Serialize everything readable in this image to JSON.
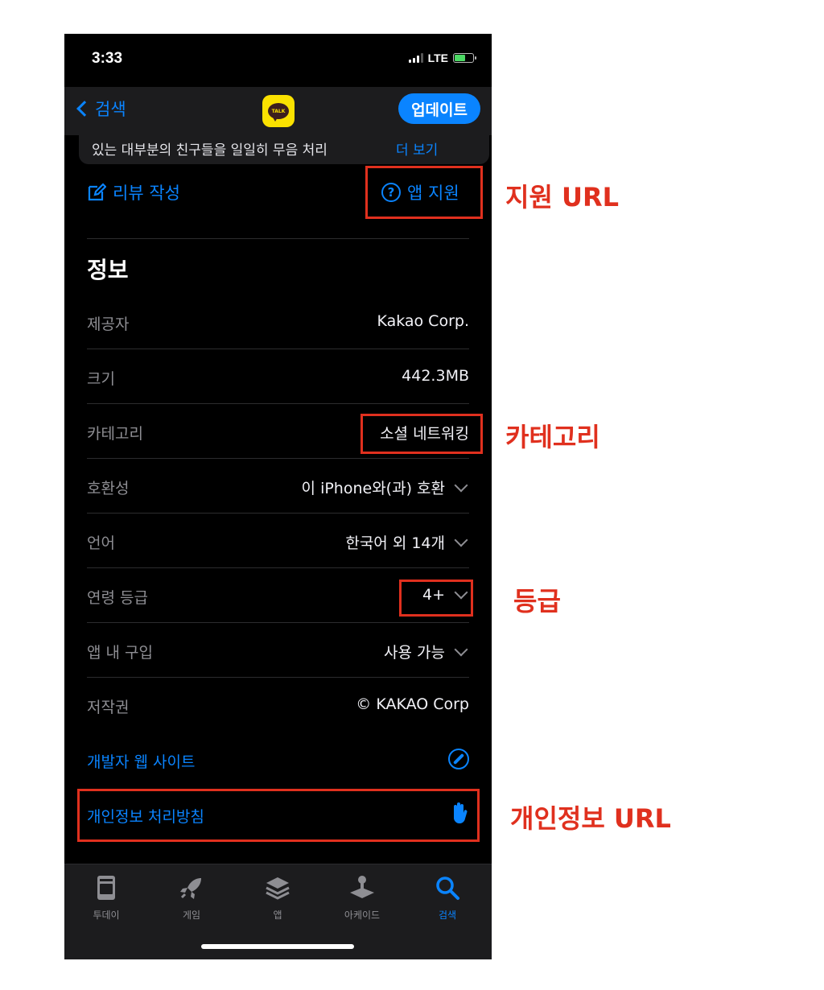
{
  "status": {
    "time": "3:33",
    "network": "LTE"
  },
  "nav": {
    "back_label": "검색",
    "app_icon_text": "TALK",
    "update_label": "업데이트"
  },
  "description": {
    "text": "있는 대부분의 친구들을 일일히 무음 처리",
    "more_label": "더 보기"
  },
  "actions": {
    "review_label": "리뷰 작성",
    "support_label": "앱 지원"
  },
  "info": {
    "title": "정보",
    "rows": [
      {
        "label": "제공자",
        "value": "Kakao Corp."
      },
      {
        "label": "크기",
        "value": "442.3MB"
      },
      {
        "label": "카테고리",
        "value": "소셜 네트워킹"
      },
      {
        "label": "호환성",
        "value": "이 iPhone와(과) 호환"
      },
      {
        "label": "언어",
        "value": "한국어 외 14개"
      },
      {
        "label": "연령 등급",
        "value": "4+"
      },
      {
        "label": "앱 내 구입",
        "value": "사용 가능"
      },
      {
        "label": "저작권",
        "value": "© KAKAO Corp"
      }
    ],
    "links": {
      "developer": "개발자 웹 사이트",
      "privacy": "개인정보 처리방침"
    }
  },
  "tabs": [
    {
      "label": "투데이",
      "icon": "today-icon"
    },
    {
      "label": "게임",
      "icon": "rocket-icon"
    },
    {
      "label": "앱",
      "icon": "layers-icon"
    },
    {
      "label": "아케이드",
      "icon": "joystick-icon"
    },
    {
      "label": "검색",
      "icon": "search-icon",
      "active": true
    }
  ],
  "annotations": {
    "support": "지원 URL",
    "category": "카테고리",
    "rating": "등급",
    "privacy": "개인정보 URL"
  },
  "colors": {
    "accent": "#0a84ff",
    "annotation": "#e0301e",
    "kakao": "#fae100"
  }
}
